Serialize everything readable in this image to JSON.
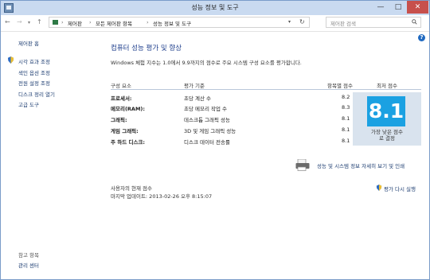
{
  "window": {
    "title": "성능 정보 및 도구",
    "buttons": {
      "minimize": "—",
      "maximize": "□",
      "close": "✕"
    }
  },
  "nav": {
    "back": "←",
    "forward": "→",
    "dropdown": "▾",
    "up": "↑"
  },
  "address": {
    "crumbs": [
      "제어판",
      "모든 제어판 항목",
      "성능 정보 및 도구"
    ],
    "separator": "›",
    "dropdown": "▾",
    "refresh": "↻"
  },
  "search": {
    "placeholder": "제어판 검색"
  },
  "sidebar": {
    "home": "제어판 홈",
    "links": [
      "시각 효과 조정",
      "색인 옵션 조정",
      "전원 설정 조정",
      "디스크 정리 열기",
      "고급 도구"
    ],
    "see_also_label": "참고 항목",
    "see_also_links": [
      "관리 센터"
    ]
  },
  "main": {
    "help": "?",
    "title": "컴퓨터 성능 평가 및 향상",
    "description": "Windows 체험 지수는 1.0에서 9.9까지의 점수로 주요 시스템 구성 요소를 평가합니다.",
    "headers": {
      "component": "구성 요소",
      "criteria": "평가 기준",
      "subscore": "항목별 점수",
      "base": "최저 점수"
    },
    "rows": [
      {
        "component": "프로세서:",
        "criteria": "초당 계산 수",
        "score": "8.2"
      },
      {
        "component": "메모리(RAM):",
        "criteria": "초당 메모리 작업 수",
        "score": "8.3"
      },
      {
        "component": "그래픽:",
        "criteria": "데스크톱 그래픽 성능",
        "score": "8.1"
      },
      {
        "component": "게임 그래픽:",
        "criteria": "3D 및 게임 그래픽 성능",
        "score": "8.1"
      },
      {
        "component": "주 하드 디스크:",
        "criteria": "디스크 데이터 전송률",
        "score": "8.1"
      }
    ],
    "base_score": "8.1",
    "base_desc_1": "가장 낮은 점수",
    "base_desc_2": "로 결정",
    "print_link": "성능 및 시스템 정보 자세히 보기 및 인쇄",
    "status_label": "사용자의 현재 점수",
    "last_update": "마지막 업데이트: 2013-02-26 오후 8:15:07",
    "rerun_link": "평가 다시 실행"
  },
  "colors": {
    "accent": "#1ba1e2",
    "link": "#1e3e72",
    "title": "#1e3e8c",
    "panel": "#d9e3ee"
  }
}
